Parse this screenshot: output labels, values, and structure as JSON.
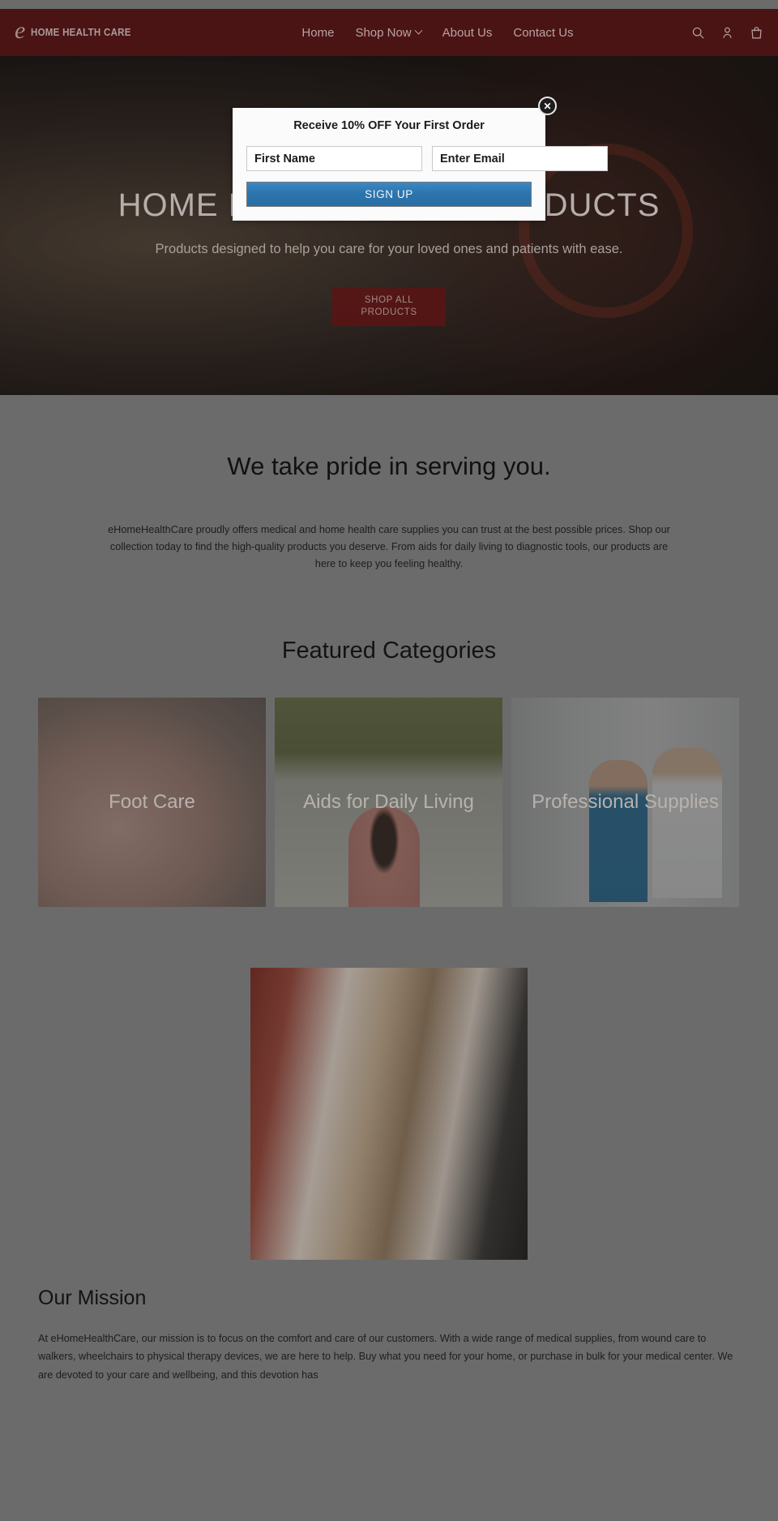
{
  "header": {
    "logo_mark": "e",
    "logo_text": "HOME HEALTH CARE",
    "nav": [
      {
        "label": "Home",
        "has_caret": false
      },
      {
        "label": "Shop Now",
        "has_caret": true
      },
      {
        "label": "About Us",
        "has_caret": false
      },
      {
        "label": "Contact Us",
        "has_caret": false
      }
    ],
    "icons": [
      "search-icon",
      "account-icon",
      "cart-icon"
    ],
    "background_color": "#4a1414",
    "text_color": "#b9a3a3"
  },
  "popup": {
    "title": "Receive 10% OFF Your First Order",
    "first_name_placeholder": "First Name",
    "first_name_value": "",
    "email_placeholder": "Enter Email",
    "email_value": "",
    "submit_label": "SIGN UP",
    "submit_color": "#2b74ac",
    "close_label": "✕"
  },
  "hero": {
    "title": "HOME HEALTH CARE PRODUCTS",
    "subtitle": "Products designed to help you care for your loved ones and patients with ease.",
    "button_label": "SHOP ALL PRODUCTS",
    "button_color": "#5d1414"
  },
  "pride": {
    "title": "We take pride in serving you.",
    "body": "eHomeHealthCare proudly offers medical and home health care supplies you can trust at the best possible prices. Shop our collection today to find the high-quality products you deserve. From aids for daily living to diagnostic tools, our products are here to keep you feeling healthy."
  },
  "featured": {
    "title": "Featured Categories",
    "categories": [
      {
        "label": "Foot Care"
      },
      {
        "label": "Aids for Daily Living"
      },
      {
        "label": "Professional Supplies"
      }
    ]
  },
  "mission": {
    "title": "Our Mission",
    "body": "At eHomeHealthCare, our mission is to focus on the comfort and care of our customers. With a wide range of medical supplies, from wound care to walkers, wheelchairs to physical therapy devices, we are here to help. Buy what you need for your home, or purchase in bulk for your medical center. We are devoted to your care and wellbeing, and this devotion has"
  }
}
